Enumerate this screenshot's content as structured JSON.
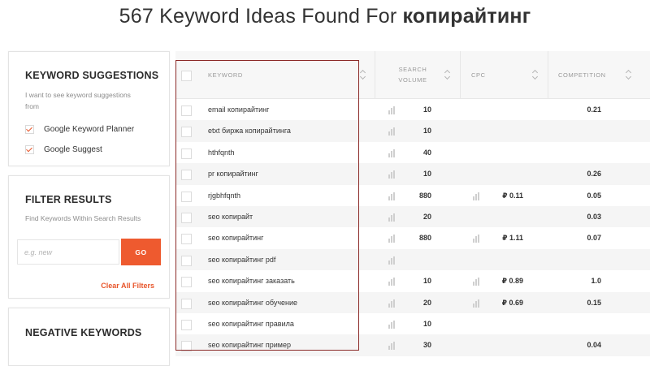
{
  "header": {
    "title_prefix": "567 Keyword Ideas Found For ",
    "title_keyword": "копирайтинг"
  },
  "suggestions": {
    "title": "KEYWORD SUGGESTIONS",
    "desc_line1": "I want to see keyword suggestions",
    "desc_line2": "from",
    "options": [
      "Google Keyword Planner",
      "Google Suggest"
    ]
  },
  "filter": {
    "title": "FILTER RESULTS",
    "desc": "Find Keywords Within Search Results",
    "placeholder": "e.g. new",
    "go_label": "GO",
    "clear_label": "Clear All Filters"
  },
  "negative": {
    "title": "NEGATIVE KEYWORDS"
  },
  "table": {
    "headers": {
      "keyword": "KEYWORD",
      "volume_line1": "SEARCH",
      "volume_line2": "VOLUME",
      "cpc": "CPC",
      "competition": "COMPETITION"
    },
    "rows": [
      {
        "keyword": "email копирайтинг",
        "volume": "10",
        "cpc": "",
        "competition": "0.21"
      },
      {
        "keyword": "etxt биржа копирайтинга",
        "volume": "10",
        "cpc": "",
        "competition": ""
      },
      {
        "keyword": "hthfqnth",
        "volume": "40",
        "cpc": "",
        "competition": ""
      },
      {
        "keyword": "pr копирайтинг",
        "volume": "10",
        "cpc": "",
        "competition": "0.26"
      },
      {
        "keyword": "rjgbhfqnth",
        "volume": "880",
        "cpc": "₽ 0.11",
        "competition": "0.05"
      },
      {
        "keyword": "seo копирайт",
        "volume": "20",
        "cpc": "",
        "competition": "0.03"
      },
      {
        "keyword": "seo копирайтинг",
        "volume": "880",
        "cpc": "₽ 1.11",
        "competition": "0.07"
      },
      {
        "keyword": "seo копирайтинг pdf",
        "volume": "",
        "cpc": "",
        "competition": ""
      },
      {
        "keyword": "seo копирайтинг заказать",
        "volume": "10",
        "cpc": "₽ 0.89",
        "competition": "1.0"
      },
      {
        "keyword": "seo копирайтинг обучение",
        "volume": "20",
        "cpc": "₽ 0.69",
        "competition": "0.15"
      },
      {
        "keyword": "seo копирайтинг правила",
        "volume": "10",
        "cpc": "",
        "competition": ""
      },
      {
        "keyword": "seo копирайтинг пример",
        "volume": "30",
        "cpc": "",
        "competition": "0.04"
      }
    ]
  },
  "colors": {
    "accent": "#ee5a2f",
    "highlight": "#8b2a28"
  }
}
